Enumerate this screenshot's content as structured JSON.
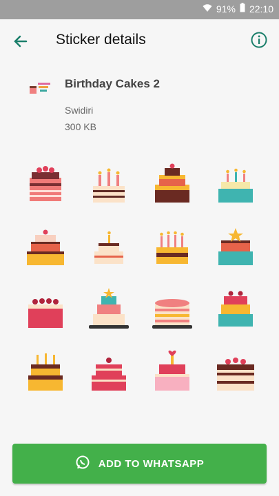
{
  "status": {
    "battery": "91%",
    "time": "22:10"
  },
  "header": {
    "title": "Sticker details"
  },
  "pack": {
    "name": "Birthday Cakes 2",
    "publisher": "Swidiri",
    "size": "300 KB"
  },
  "stickers": [
    {
      "icon": "layer-cake-cherries-icon"
    },
    {
      "icon": "candle-cake-icon"
    },
    {
      "icon": "chocolate-drip-cake-icon"
    },
    {
      "icon": "teal-candle-cake-icon"
    },
    {
      "icon": "three-tier-cake-icon"
    },
    {
      "icon": "small-candle-cake-icon"
    },
    {
      "icon": "yellow-candle-cake-icon"
    },
    {
      "icon": "teal-star-cake-icon"
    },
    {
      "icon": "red-cherry-cake-icon"
    },
    {
      "icon": "tiered-stand-cake-icon"
    },
    {
      "icon": "striped-stand-cake-icon"
    },
    {
      "icon": "colorful-tier-cake-icon"
    },
    {
      "icon": "yellow-drip-cake-icon"
    },
    {
      "icon": "pink-cherry-tier-cake-icon"
    },
    {
      "icon": "pink-heart-cake-icon"
    },
    {
      "icon": "chocolate-cherry-cake-icon"
    }
  ],
  "button": {
    "label": "ADD TO WHATSAPP"
  },
  "colors": {
    "accent": "#43b04a",
    "appbar_icon": "#1b7f6b"
  }
}
